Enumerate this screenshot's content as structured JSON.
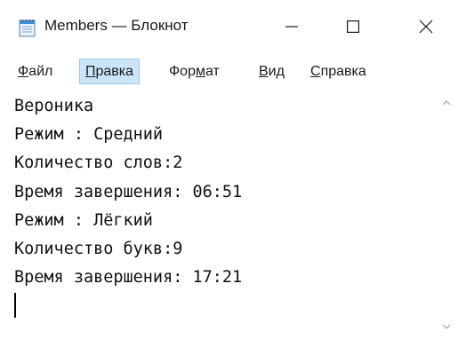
{
  "window": {
    "title": "Members — Блокнот",
    "minimize_icon": "minimize-icon",
    "maximize_icon": "maximize-icon",
    "close_icon": "close-icon",
    "app_icon": "notepad-icon"
  },
  "menu": {
    "items": [
      {
        "label_pre": "",
        "label_u": "Ф",
        "label_post": "айл"
      },
      {
        "label_pre": "",
        "label_u": "П",
        "label_post": "равка"
      },
      {
        "label_pre": "Фор",
        "label_u": "м",
        "label_post": "ат"
      },
      {
        "label_pre": "",
        "label_u": "В",
        "label_post": "ид"
      },
      {
        "label_pre": "",
        "label_u": "С",
        "label_post": "правка"
      }
    ],
    "active_index": 1
  },
  "editor": {
    "lines": [
      "Вероника",
      "Режим : Средний",
      "Количество слов:2",
      "Время завершения: 06:51",
      "Режим : Лёгкий",
      "Количество букв:9",
      "Время завершения: 17:21"
    ]
  },
  "colors": {
    "menu_highlight": "#cce4f7",
    "menu_highlight_border": "#99c9ef",
    "scroll_arrow": "#a0a0a0"
  }
}
